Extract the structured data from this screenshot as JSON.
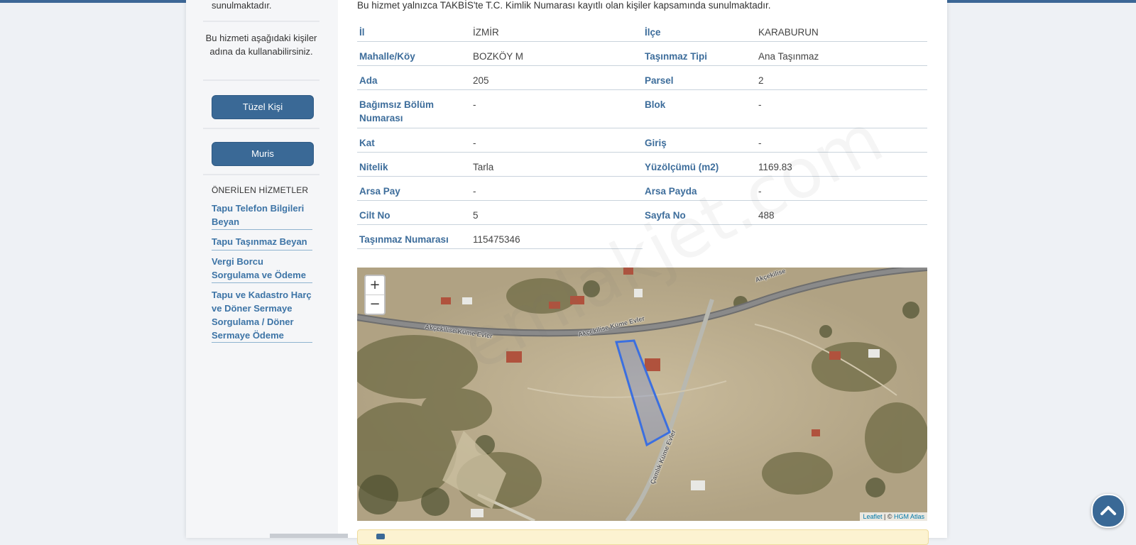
{
  "sidebar": {
    "top_text": "sunulmaktadır.",
    "note": "Bu hizmeti aşağıdaki kişiler adına da kullanabilirsiniz.",
    "buttons": [
      "Tüzel Kişi",
      "Muris"
    ],
    "recommended_title": "ÖNERİLEN HİZMETLER",
    "links": [
      "Tapu Telefon Bilgileri Beyan",
      "Tapu Taşınmaz Beyan",
      "Vergi Borcu Sorgulama ve Ödeme",
      "Tapu ve Kadastro Harç ve Döner Sermaye Sorgulama / Döner Sermaye Ödeme"
    ]
  },
  "main": {
    "intro": "Bu hizmet yalnızca TAKBİS'te T.C. Kimlik Numarası kayıtlı olan kişiler kapsamında sunulmaktadır.",
    "rows": [
      {
        "l1": "İl",
        "v1": "İZMİR",
        "l2": "İlçe",
        "v2": "KARABURUN"
      },
      {
        "l1": "Mahalle/Köy",
        "v1": "BOZKÖY M",
        "l2": "Taşınmaz Tipi",
        "v2": "Ana Taşınmaz"
      },
      {
        "l1": "Ada",
        "v1": "205",
        "l2": "Parsel",
        "v2": "2"
      },
      {
        "l1": "Bağımsız Bölüm Numarası",
        "v1": "-",
        "l2": "Blok",
        "v2": "-"
      },
      {
        "l1": "Kat",
        "v1": "-",
        "l2": "Giriş",
        "v2": "-"
      },
      {
        "l1": "Nitelik",
        "v1": "Tarla",
        "l2": "Yüzölçümü (m2)",
        "v2": "1169.83"
      },
      {
        "l1": "Arsa Pay",
        "v1": "-",
        "l2": "Arsa Payda",
        "v2": "-"
      },
      {
        "l1": "Cilt No",
        "v1": "5",
        "l2": "Sayfa No",
        "v2": "488"
      },
      {
        "l1": "Taşınmaz Numarası",
        "v1": "115475346"
      }
    ]
  },
  "map": {
    "zoom_in": "+",
    "zoom_out": "−",
    "road_labels": [
      "Akçekilise Küme Evler",
      "Akçekilise Küme Evler",
      "Akçekilise",
      "Çamlık Küme Evler"
    ],
    "attribution_link": "Leaflet",
    "attribution_sep": " | © ",
    "attribution_source": "HGM Atlas",
    "parcel_color": "#3b6fe0"
  },
  "watermark": "emlakjet.com",
  "scroll_top_icon": "chevron-up-icon",
  "colors": {
    "primary": "#3a6996",
    "label": "#3d6d9b",
    "link": "#3d74a6"
  }
}
